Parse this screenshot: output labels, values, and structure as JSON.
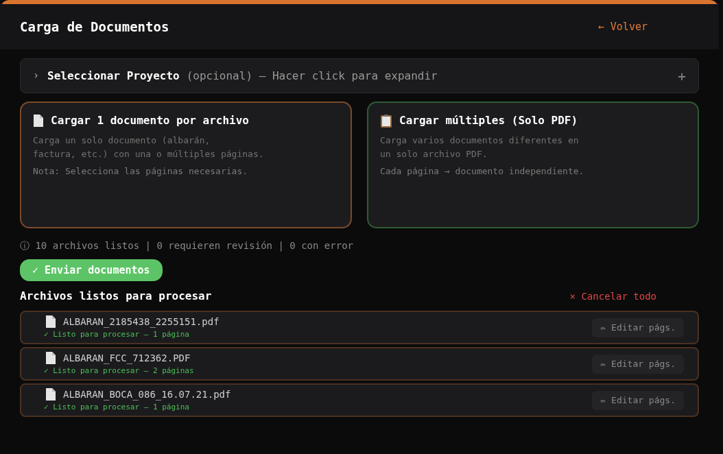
{
  "header": {
    "title": "Carga de Documentos",
    "back_link": "← Volver"
  },
  "project_selector": {
    "chevron": "›",
    "label": "Seleccionar Proyecto",
    "hint": "(opcional) — Hacer click para expandir",
    "expand": "+",
    "expanded": false
  },
  "upload_modes": [
    {
      "kind": "single",
      "title": "Cargar 1 documento por archivo",
      "lines": [
        "Carga un solo documento (albarán,",
        "factura, etc.) con una o múltiples páginas."
      ],
      "note": "Nota: Selecciona las páginas necesarias.",
      "color": "#7a4a2a"
    },
    {
      "kind": "multiple",
      "title": "Cargar múltiples (Solo PDF)",
      "lines": [
        "Carga varios documentos diferentes en",
        "un solo archivo PDF."
      ],
      "note": "Cada página → documento independiente.",
      "color": "#2f5a34"
    }
  ],
  "summary": "ⓘ 10 archivos listos | 0 requieren revisión | 0 con error",
  "submit_button": "✓ Enviar documentos",
  "files_section": {
    "title": "Archivos listos para procesar",
    "cancel_all": "× Cancelar todo"
  },
  "files": [
    {
      "name": "ALBARAN_2185438_2255151.pdf",
      "status": "✓ Listo para procesar — 1 página",
      "edit_button": "✏ Editar págs."
    },
    {
      "name": "ALBARAN_FCC_712362.PDF",
      "status": "✓ Listo para procesar — 2 páginas",
      "edit_button": "✏ Editar págs."
    },
    {
      "name": "ALBARAN_BOCA_086_16.07.21.pdf",
      "status": "✓ Listo para procesar — 1 página",
      "edit_button": "✏ Editar págs."
    }
  ]
}
